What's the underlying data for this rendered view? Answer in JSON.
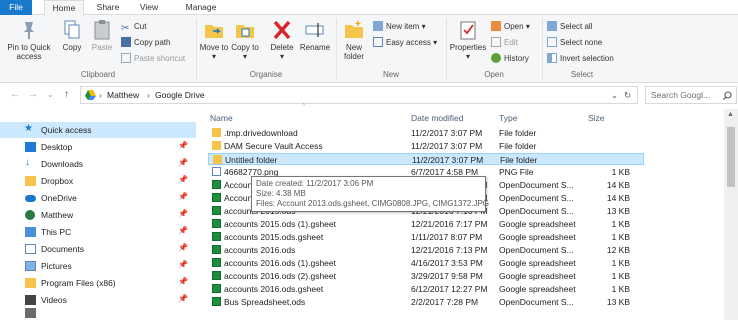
{
  "tabs": [
    "File",
    "Home",
    "Share",
    "View",
    "Manage"
  ],
  "ribbon": {
    "clipboard": {
      "pin": "Pin to Quick access",
      "copy": "Copy",
      "paste": "Paste",
      "cut": "Cut",
      "copy_path": "Copy path",
      "paste_shortcut": "Paste shortcut",
      "label": "Clipboard"
    },
    "organise": {
      "move_to": "Move to",
      "copy_to": "Copy to",
      "delete": "Delete",
      "rename": "Rename",
      "label": "Organise"
    },
    "new": {
      "new_folder": "New folder",
      "new_item": "New item",
      "easy_access": "Easy access",
      "label": "New"
    },
    "open": {
      "properties": "Properties",
      "open": "Open",
      "edit": "Edit",
      "history": "History",
      "label": "Open"
    },
    "select": {
      "select_all": "Select all",
      "select_none": "Select none",
      "invert": "Invert selection",
      "label": "Select"
    }
  },
  "address": {
    "crumbs": [
      "Matthew",
      "Google Drive"
    ],
    "search_placeholder": "Search Googl..."
  },
  "nav": [
    {
      "label": "Quick access",
      "icon": "star-icon",
      "pinned": false
    },
    {
      "label": "Desktop",
      "icon": "desktop-icon",
      "pinned": true
    },
    {
      "label": "Downloads",
      "icon": "download-icon",
      "pinned": true
    },
    {
      "label": "Dropbox",
      "icon": "folder-icon",
      "pinned": true
    },
    {
      "label": "OneDrive",
      "icon": "cloud-icon",
      "pinned": true
    },
    {
      "label": "Matthew",
      "icon": "user-icon",
      "pinned": true
    },
    {
      "label": "This PC",
      "icon": "computer-icon",
      "pinned": true
    },
    {
      "label": "Documents",
      "icon": "documents-icon",
      "pinned": true
    },
    {
      "label": "Pictures",
      "icon": "pictures-icon",
      "pinned": true
    },
    {
      "label": "Program Files (x86)",
      "icon": "folder-icon",
      "pinned": true
    },
    {
      "label": "Videos",
      "icon": "videos-icon",
      "pinned": true
    }
  ],
  "columns": {
    "name": "Name",
    "date": "Date modified",
    "type": "Type",
    "size": "Size"
  },
  "files": [
    {
      "name": ".tmp.drivedownload",
      "date": "11/2/2017 3:07 PM",
      "type": "File folder",
      "size": "",
      "icon": "folder-icon"
    },
    {
      "name": "DAM Secure Vault Access",
      "date": "11/2/2017 3:07 PM",
      "type": "File folder",
      "size": "",
      "icon": "folder-icon"
    },
    {
      "name": "Untitled folder",
      "date": "11/2/2017 3:07 PM",
      "type": "File folder",
      "size": "",
      "icon": "folder-icon"
    },
    {
      "name": "46682770.png",
      "date": "6/7/2017 4:58 PM",
      "type": "PNG File",
      "size": "1 KB",
      "icon": "image-icon"
    },
    {
      "name": "Account 2013.ods",
      "date": "12/21/2016 7:16 PM",
      "type": "OpenDocument S...",
      "size": "14 KB",
      "icon": "spreadsheet-icon"
    },
    {
      "name": "Account 2014.ods",
      "date": "12/21/2016 7:16 PM",
      "type": "OpenDocument S...",
      "size": "14 KB",
      "icon": "spreadsheet-icon"
    },
    {
      "name": "accounts 2015.ods",
      "date": "12/21/2016 7:16 PM",
      "type": "OpenDocument S...",
      "size": "13 KB",
      "icon": "spreadsheet-icon"
    },
    {
      "name": "accounts 2015.ods (1).gsheet",
      "date": "12/21/2016 7:17 PM",
      "type": "Google spreadsheet",
      "size": "1 KB",
      "icon": "spreadsheet-icon"
    },
    {
      "name": "accounts 2015.ods.gsheet",
      "date": "1/11/2017 8:07 PM",
      "type": "Google spreadsheet",
      "size": "1 KB",
      "icon": "spreadsheet-icon"
    },
    {
      "name": "accounts 2016.ods",
      "date": "12/21/2016 7:13 PM",
      "type": "OpenDocument S...",
      "size": "12 KB",
      "icon": "spreadsheet-icon"
    },
    {
      "name": "accounts 2016.ods (1).gsheet",
      "date": "4/16/2017 3:53 PM",
      "type": "Google spreadsheet",
      "size": "1 KB",
      "icon": "spreadsheet-icon"
    },
    {
      "name": "accounts 2016.ods (2).gsheet",
      "date": "3/29/2017 9:58 PM",
      "type": "Google spreadsheet",
      "size": "1 KB",
      "icon": "spreadsheet-icon"
    },
    {
      "name": "accounts 2016.ods.gsheet",
      "date": "6/12/2017 12:27 PM",
      "type": "Google spreadsheet",
      "size": "1 KB",
      "icon": "spreadsheet-icon"
    },
    {
      "name": "Bus Spreadsheet.ods",
      "date": "2/2/2017 7:28 PM",
      "type": "OpenDocument S...",
      "size": "13 KB",
      "icon": "spreadsheet-icon"
    }
  ],
  "tooltip": {
    "created": "Date created: 11/2/2017 3:06 PM",
    "size": "Size: 4.38 MB",
    "files": "Files: Account 2013.ods.gsheet, CIMG0808.JPG, CIMG1372.JPG"
  },
  "colors": {
    "accent": "#1979ca",
    "selection": "#cce8ff",
    "folder": "#f5c54b",
    "sheet": "#1e8e3e"
  }
}
